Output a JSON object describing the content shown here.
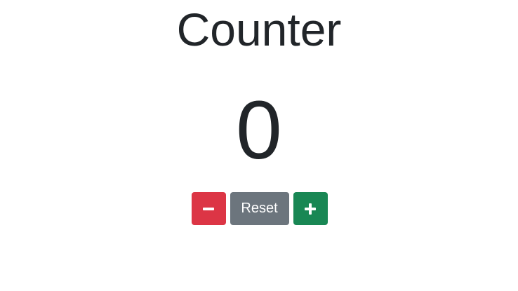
{
  "title": "Counter",
  "count": "0",
  "buttons": {
    "decrement_icon": "minus-icon",
    "reset_label": "Reset",
    "increment_icon": "plus-icon"
  },
  "colors": {
    "decrement": "#dc3545",
    "reset": "#6c757d",
    "increment": "#198754",
    "text": "#212529"
  }
}
